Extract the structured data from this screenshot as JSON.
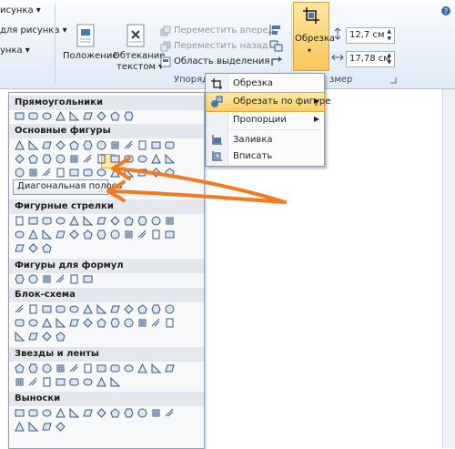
{
  "ribbon": {
    "left_items": [
      "исунка ▾",
      "для рисунка ▾",
      "унка ▾"
    ],
    "position_label": "Положение",
    "wrap_label_1": "Обтекание",
    "wrap_label_2": "текстом ▾",
    "bring_forward": "Переместить вперед",
    "send_backward": "Переместить назад",
    "selection_pane": "Область выделения",
    "arrange_group": "Упорядочить",
    "crop_label": "Обрезка",
    "crop_arrow": "▾",
    "size_group": "змер",
    "height_value": "12,7 см",
    "width_value": "17,78 см"
  },
  "menu": {
    "items": [
      {
        "label": "Обрезка"
      },
      {
        "label": "Обрезать по фигуре",
        "submenu": true,
        "active": true
      },
      {
        "label": "Пропорции",
        "submenu": true
      },
      {
        "label": "Заливка"
      },
      {
        "label": "Вписать"
      }
    ]
  },
  "gallery": {
    "categories": [
      "Прямоугольники",
      "Основные фигуры",
      "Фигурные стрелки",
      "Фигуры для формул",
      "Блок-схема",
      "Звезды и ленты",
      "Выноски"
    ],
    "tooltip": "Диагональная полоса"
  },
  "colors": {
    "arrow": "#f47a1f",
    "highlight": "#fde7a3",
    "shape_stroke": "#3d5a80",
    "shape_fill": "#dbe6f4"
  }
}
